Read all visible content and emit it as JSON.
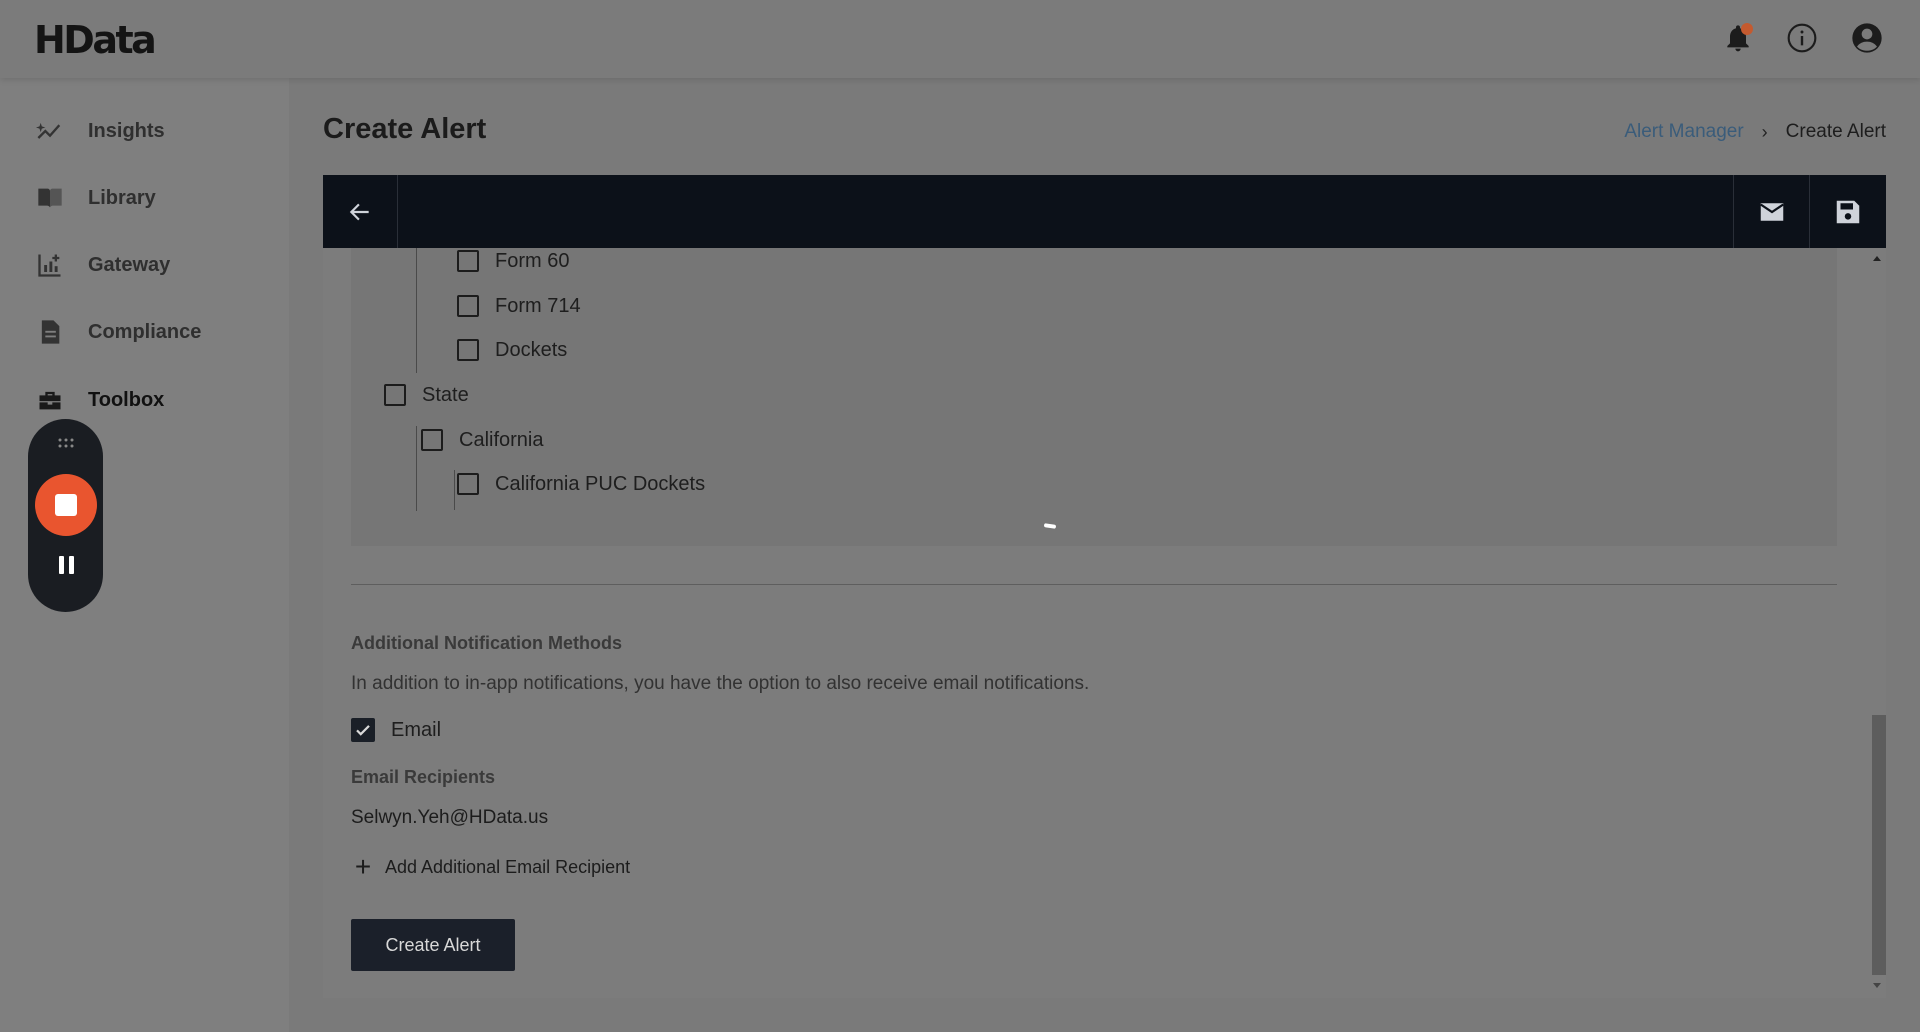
{
  "app": {
    "logo": "HData"
  },
  "topbar": {
    "icons": [
      "bell-icon",
      "info-icon",
      "account-icon"
    ],
    "notification_dot_color": "#c45a2f"
  },
  "sidebar": {
    "items": [
      {
        "label": "Insights",
        "icon": "insights-icon"
      },
      {
        "label": "Library",
        "icon": "library-icon"
      },
      {
        "label": "Gateway",
        "icon": "gateway-icon"
      },
      {
        "label": "Compliance",
        "icon": "compliance-icon"
      },
      {
        "label": "Toolbox",
        "icon": "toolbox-icon",
        "active": true
      }
    ],
    "footer_icon": "swap-icon"
  },
  "recorder": {
    "stop_color": "#e9552f"
  },
  "page": {
    "title": "Create Alert",
    "breadcrumb": {
      "parent": "Alert Manager",
      "current": "Create Alert"
    }
  },
  "toolbar": {
    "icons": [
      "back-arrow-icon",
      "email-icon",
      "save-icon"
    ]
  },
  "tree": {
    "items": [
      {
        "label": "Form 60",
        "checked": false
      },
      {
        "label": "Form 714",
        "checked": false
      },
      {
        "label": "Dockets",
        "checked": false
      },
      {
        "label": "State",
        "checked": false
      },
      {
        "label": "California",
        "checked": false
      },
      {
        "label": "California PUC Dockets",
        "checked": false
      }
    ]
  },
  "notifications": {
    "title": "Additional Notification Methods",
    "description": "In addition to in-app notifications, you have the option to also receive email notifications.",
    "email_label": "Email",
    "email_checked": true,
    "recipients_title": "Email Recipients",
    "recipient": "Selwyn.Yeh@HData.us",
    "add_recipient_label": "Add Additional Email Recipient"
  },
  "actions": {
    "create_label": "Create Alert"
  },
  "colors": {
    "toolbar_bg": "#0c1119",
    "button_bg": "#1b202a",
    "link": "#3a5c7a"
  }
}
